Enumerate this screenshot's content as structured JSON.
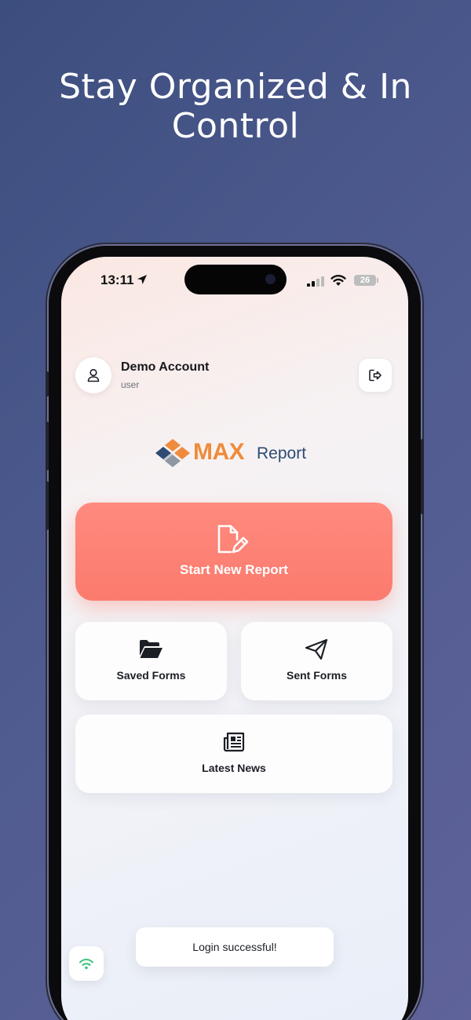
{
  "headline": "Stay Organized & In Control",
  "status_bar": {
    "time": "13:11",
    "battery": "26",
    "icons": [
      "location-arrow-icon",
      "cellular-signal-icon",
      "wifi-icon",
      "battery-icon"
    ]
  },
  "account": {
    "name": "Demo Account",
    "role": "user",
    "avatar_icon": "user-icon",
    "logout_icon": "logout-icon"
  },
  "logo": {
    "max": "MAX",
    "report": "Report",
    "colors": {
      "max": "#ef8b3b",
      "report": "#2d4b73"
    }
  },
  "actions": {
    "start_new_report": {
      "label": "Start New Report",
      "icon": "edit-document-icon",
      "color": "#fb7b6e"
    },
    "saved_forms": {
      "label": "Saved Forms",
      "icon": "folder-open-icon"
    },
    "sent_forms": {
      "label": "Sent Forms",
      "icon": "paper-plane-icon"
    },
    "latest_news": {
      "label": "Latest News",
      "icon": "newspaper-icon"
    }
  },
  "toast": {
    "message": "Login successful!"
  },
  "network_status": {
    "icon": "wifi-icon",
    "color": "#3ac27a"
  }
}
